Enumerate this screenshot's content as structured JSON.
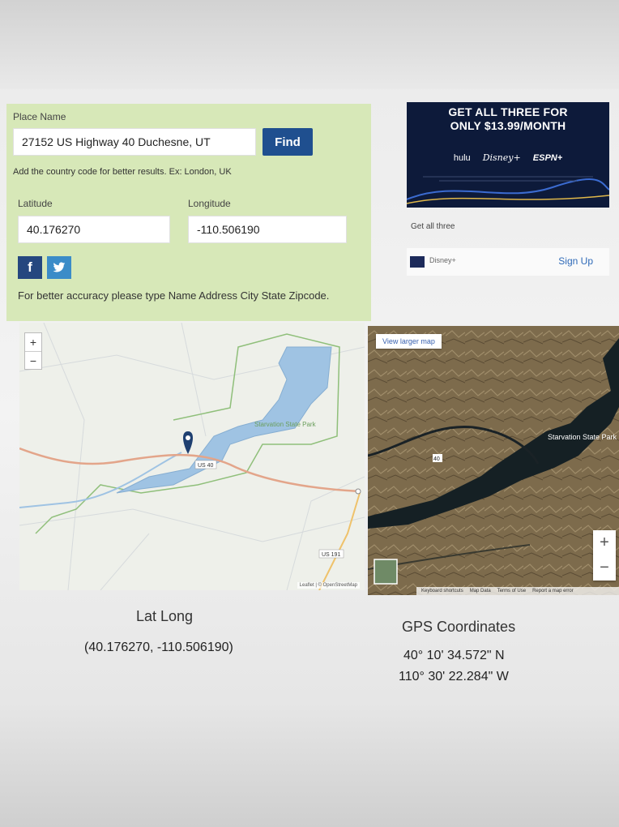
{
  "place": {
    "place_name_label": "Place Name",
    "place_name_value": "27152 US Highway 40 Duchesne, UT",
    "find_label": "Find",
    "country_hint": "Add the country code for better results. Ex: London, UK",
    "latitude_label": "Latitude",
    "latitude_value": "40.176270",
    "longitude_label": "Longitude",
    "longitude_value": "-110.506190",
    "accuracy_hint": "For better accuracy please type Name Address City State Zipcode."
  },
  "social": {
    "facebook": "f",
    "twitter": "t"
  },
  "ad": {
    "headline_line1": "GET ALL THREE FOR",
    "headline_line2": "ONLY $13.99/MONTH",
    "brand1": "hulu",
    "brand2": "Disney+",
    "brand3": "ESPN+",
    "tagline": "Get all three",
    "advertiser": "Disney+",
    "signup_label": "Sign Up"
  },
  "map_left": {
    "zoom_in": "+",
    "zoom_out": "−",
    "park_label": "Starvation State Park",
    "road_label": "US 40",
    "road_label2": "US 191",
    "attribution": "Leaflet | © OpenStreetMap"
  },
  "map_right": {
    "larger_map": "View larger map",
    "park_label": "Starvation State Park",
    "road_label": "40",
    "zoom_in": "+",
    "zoom_out": "−",
    "footer": [
      "Keyboard shortcuts",
      "Map Data",
      "Terms of Use",
      "Report a map error"
    ]
  },
  "results": {
    "latlong_title": "Lat Long",
    "latlong_value": "(40.176270, -110.506190)",
    "gps_title": "GPS Coordinates",
    "gps_lat": "40° 10' 34.572\" N",
    "gps_lon": "110° 30' 22.284\" W"
  },
  "colors": {
    "panel": "#d7e8b8",
    "find_button": "#1f4f8f",
    "facebook": "#25477f",
    "twitter": "#3b8cc8",
    "ad_bg": "#0d1a3a",
    "water": "#9fc3e3",
    "park_border": "#8fbf7a",
    "road": "#e3a58a",
    "marker": "#1e3f70"
  }
}
